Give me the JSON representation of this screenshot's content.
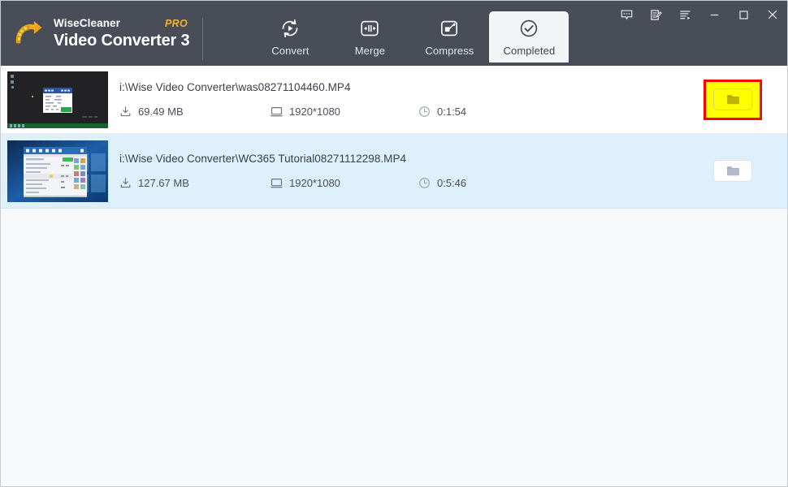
{
  "window": {
    "brand_company": "WiseCleaner",
    "brand_edition": "PRO",
    "brand_product": "Video Converter 3"
  },
  "titlebar_icons": [
    {
      "name": "feedback-icon",
      "label": "Feedback"
    },
    {
      "name": "edit-note-icon",
      "label": "Notes"
    },
    {
      "name": "menu-list-icon",
      "label": "Menu"
    },
    {
      "name": "minimize-icon",
      "label": "Minimize"
    },
    {
      "name": "maximize-icon",
      "label": "Maximize"
    },
    {
      "name": "close-icon",
      "label": "Close"
    }
  ],
  "tabs": [
    {
      "id": "convert",
      "label": "Convert",
      "icon": "convert-icon",
      "active": false
    },
    {
      "id": "merge",
      "label": "Merge",
      "icon": "merge-icon",
      "active": false
    },
    {
      "id": "compress",
      "label": "Compress",
      "icon": "compress-icon",
      "active": false
    },
    {
      "id": "completed",
      "label": "Completed",
      "icon": "check-circle-icon",
      "active": true
    }
  ],
  "files": [
    {
      "path": "i:\\Wise Video Converter\\was08271104460.MP4",
      "size": "69.49 MB",
      "resolution": "1920*1080",
      "duration": "0:1:54",
      "selected": false,
      "action_label": "Open folder",
      "highlighted": true
    },
    {
      "path": "i:\\Wise Video Converter\\WC365 Tutorial08271112298.MP4",
      "size": "127.67 MB",
      "resolution": "1920*1080",
      "duration": "0:5:46",
      "selected": true,
      "action_label": "Open folder",
      "highlighted": false
    }
  ],
  "colors": {
    "titlebar": "#484d58",
    "accent_pro": "#f5b427",
    "active_tab_bg": "#f2f4f6",
    "row_selected_bg": "#ddf0fb",
    "highlight_fill": "#ffff00",
    "highlight_border": "#ff0000",
    "body_bg": "#f7f8fa"
  }
}
